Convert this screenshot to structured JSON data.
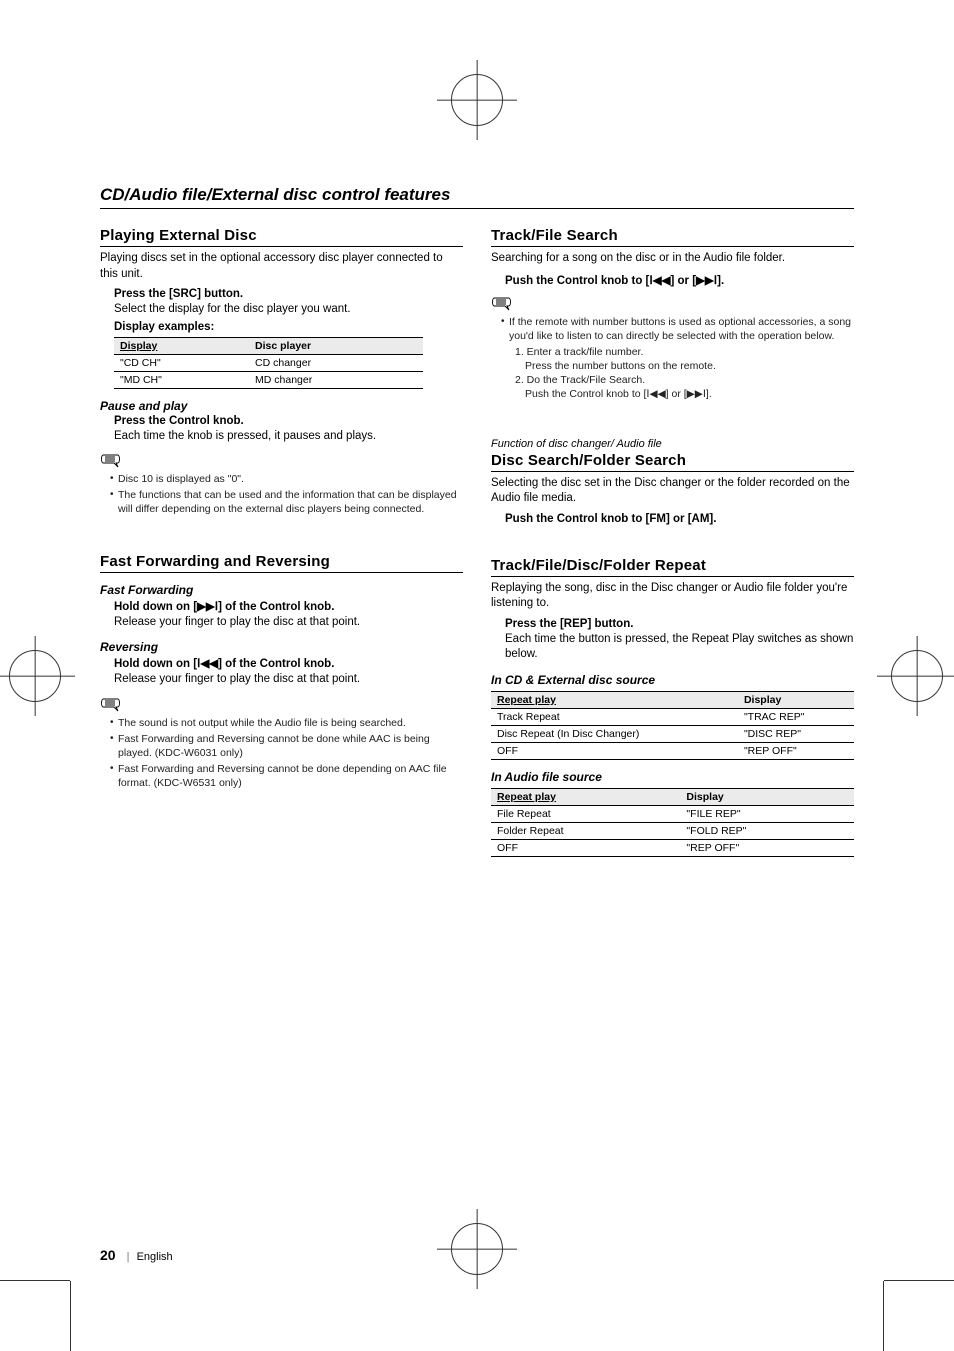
{
  "page": {
    "section_title": "CD/Audio file/External disc control features",
    "number": "20",
    "lang": "English"
  },
  "icons": {
    "prev": "⏮",
    "next": "⏭",
    "ff": "⏭",
    "rw": "⏮"
  },
  "left": {
    "playing_external": {
      "title": "Playing External Disc",
      "intro": "Playing discs set in the optional accessory disc player connected to this unit.",
      "step1": "Press the [SRC] button.",
      "step1_desc": "Select the display for the disc player you want.",
      "examples_label": "Display examples:",
      "table": {
        "h1": "Display",
        "h2": "Disc player",
        "rows": [
          {
            "c1": "\"CD CH\"",
            "c2": "CD changer"
          },
          {
            "c1": "\"MD CH\"",
            "c2": "MD changer"
          }
        ]
      },
      "pause": {
        "heading": "Pause and play",
        "step": "Press the Control knob.",
        "desc": "Each time the knob is pressed, it pauses and plays.",
        "notes": [
          "Disc 10 is displayed as \"0\".",
          "The functions that can be used and the information that can be displayed will differ depending on the external disc players being connected."
        ]
      }
    },
    "ff_rev": {
      "title": "Fast Forwarding and Reversing",
      "ff": {
        "heading": "Fast Forwarding",
        "step_pre": "Hold down on [",
        "step_post": "] of the Control knob.",
        "desc": "Release your finger to play the disc at that point."
      },
      "rev": {
        "heading": "Reversing",
        "step_pre": "Hold down on [",
        "step_post": "] of the Control knob.",
        "desc": "Release your finger to play the disc at that point."
      },
      "notes": [
        "The sound is not output while the Audio file is being searched.",
        "Fast Forwarding and Reversing cannot be done while AAC is being played. (KDC-W6031 only)",
        "Fast Forwarding and Reversing cannot be done depending on AAC file format. (KDC-W6531 only)"
      ]
    }
  },
  "right": {
    "track_search": {
      "title": "Track/File Search",
      "intro": "Searching for a song on the disc or in the Audio file folder.",
      "step_pre": "Push the Control knob to [",
      "step_mid": "] or [",
      "step_post": "].",
      "note_intro": "If the remote with number buttons is used as optional accessories, a song you'd like to listen to can directly be selected with the operation below.",
      "sub1_label": "1. Enter a track/file number.",
      "sub1_desc": "Press the number buttons on the remote.",
      "sub2_label": "2. Do the Track/File Search.",
      "sub2_desc_pre": "Push the Control knob to [",
      "sub2_desc_mid": "] or [",
      "sub2_desc_post": "]."
    },
    "disc_search": {
      "funcline": "Function of disc changer/ Audio file",
      "title": "Disc Search/Folder Search",
      "intro": "Selecting the disc set in the Disc changer or the folder recorded on the Audio file media.",
      "step": "Push the Control knob to [FM] or [AM]."
    },
    "repeat": {
      "title": "Track/File/Disc/Folder Repeat",
      "intro": "Replaying the song, disc in the Disc changer or Audio file folder you're listening to.",
      "step": "Press the [REP] button.",
      "desc": "Each time the button is pressed, the Repeat Play switches as shown below.",
      "cd_heading": "In CD & External disc source",
      "cd_table": {
        "h1": "Repeat play",
        "h2": "Display",
        "rows": [
          {
            "c1": "Track Repeat",
            "c2": "\"TRAC REP\""
          },
          {
            "c1": "Disc Repeat (In Disc Changer)",
            "c2": "\"DISC REP\""
          },
          {
            "c1": "OFF",
            "c2": "\"REP OFF\""
          }
        ]
      },
      "audio_heading": "In Audio file source",
      "audio_table": {
        "h1": "Repeat play",
        "h2": "Display",
        "rows": [
          {
            "c1": "File Repeat",
            "c2": "\"FILE REP\""
          },
          {
            "c1": "Folder Repeat",
            "c2": "\"FOLD REP\""
          },
          {
            "c1": "OFF",
            "c2": "\"REP OFF\""
          }
        ]
      }
    }
  }
}
